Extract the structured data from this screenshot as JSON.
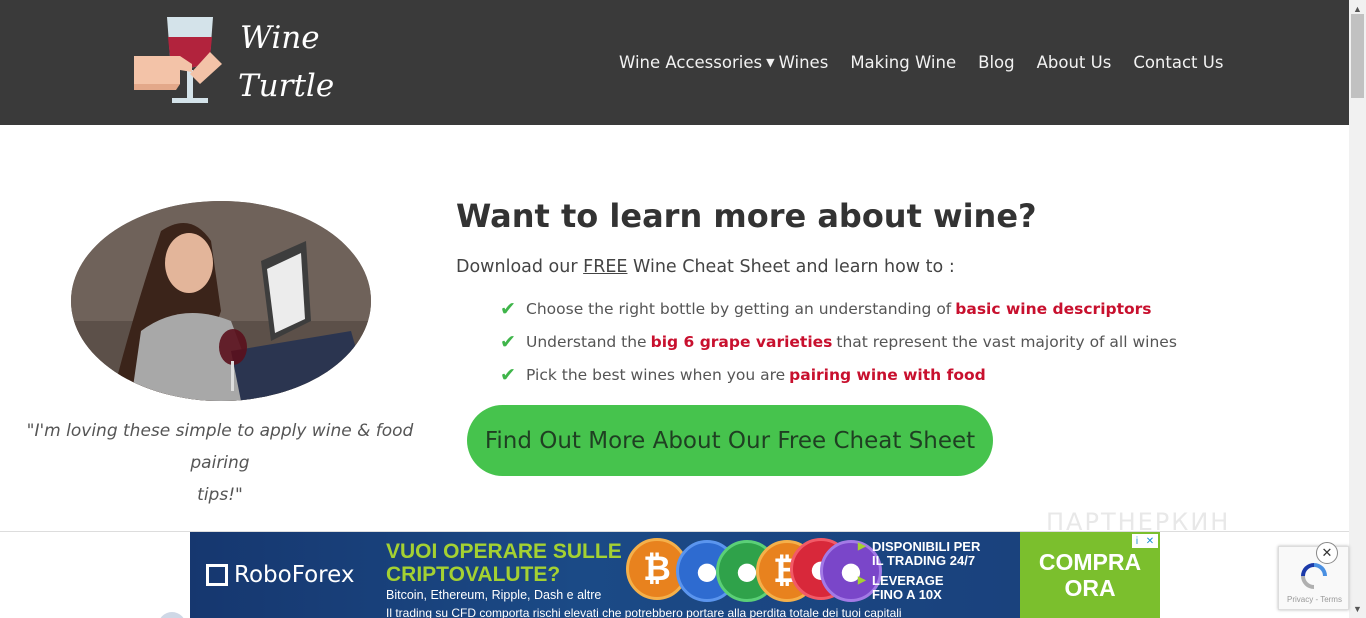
{
  "brand": {
    "logo_line1": "Wine",
    "logo_line2": "Turtle"
  },
  "nav": {
    "items": [
      {
        "label": "Wine Accessories",
        "has_dropdown": true
      },
      {
        "label": "Wines"
      },
      {
        "label": "Making Wine"
      },
      {
        "label": "Blog"
      },
      {
        "label": "About Us"
      },
      {
        "label": "Contact Us"
      }
    ]
  },
  "hero": {
    "testimonial_line1": "\"I'm loving these simple to apply wine & food pairing",
    "testimonial_line2": "tips!\"",
    "headline": "Want to learn more about wine?",
    "intro_pre": "Download our",
    "intro_free": "FREE",
    "intro_post": "Wine Cheat Sheet and learn how to :",
    "bullets": [
      {
        "pre": "Choose the right bottle by getting an understanding of",
        "highlight": "basic wine descriptors",
        "post": ""
      },
      {
        "pre": "Understand the",
        "highlight": "big 6 grape varieties",
        "post": "that represent the vast majority of all wines"
      },
      {
        "pre": "Pick the best wines when you are",
        "highlight": "pairing wine with food",
        "post": ""
      }
    ],
    "cta_label": "Find Out More About Our Free Cheat Sheet"
  },
  "watermark": "ПАРТНЕРКИН",
  "ad": {
    "brand": "RoboForex",
    "headline_line1": "VUOI OPERARE SULLE",
    "headline_line2": "CRIPTOVALUTE?",
    "subline": "Bitcoin, Ethereum, Ripple, Dash e altre",
    "disclaimer": "Il trading su CFD comporta rischi elevati che potrebbero portare alla perdita totale dei tuoi capitali",
    "right_line1": "DISPONIBILI PER",
    "right_line2": "IL TRADING 24/7",
    "right_line3": "LEVERAGE",
    "right_line4": "FINO A 10X",
    "buy_line1": "COMPRA",
    "buy_line2": "ORA",
    "info_i": "i",
    "info_x": "✕"
  },
  "recaptcha": {
    "footer": "Privacy - Terms"
  },
  "colors": {
    "header_bg": "#3a3a3a",
    "accent_red": "#c8102e",
    "cta_green": "#46c34d",
    "check_green": "#3fb54a"
  }
}
